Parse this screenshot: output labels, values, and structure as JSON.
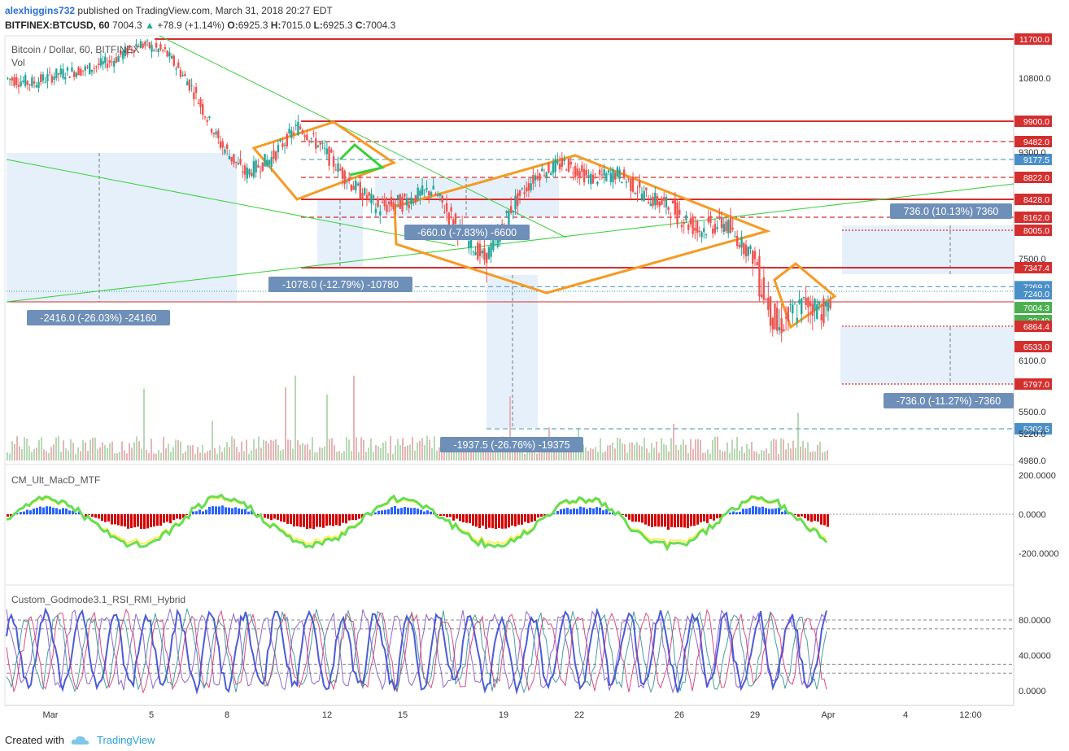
{
  "header": {
    "user": "alexhiggins732",
    "published": "published on TradingView.com, March 31, 2018 20:27 EDT",
    "symbol": "BITFINEX:BTCUSD, 60",
    "last": "7004.3",
    "change": "+78.9 (+1.14%)",
    "o_label": "O:",
    "o": "6925.3",
    "h_label": "H:",
    "h": "7015.0",
    "l_label": "L:",
    "l": "6925.3",
    "c_label": "C:",
    "c": "7004.3"
  },
  "main_pane": {
    "title": "Bitcoin / Dollar, 60, BITFINEX",
    "vol_label": "Vol"
  },
  "macd_pane": {
    "title": "CM_Ult_MacD_MTF"
  },
  "rsi_pane": {
    "title": "Custom_Godmode3.1_RSI_RMI_Hybrid"
  },
  "footer": {
    "created_with": "Created with",
    "brand": "TradingView"
  },
  "colors": {
    "bull": "#26a69a",
    "bear": "#ef5350",
    "orange": "#f59a23",
    "red_level": "#d32f2f",
    "blue_level": "#64a6c9",
    "green_line": "#39d039",
    "measure_bg": "#dcebfa",
    "measure_label": "#6e8fb8"
  },
  "chart_data": [
    {
      "type": "line",
      "title": "Bitcoin / Dollar, 60, BITFINEX",
      "x_ticks": [
        "Mar",
        "5",
        "8",
        "12",
        "15",
        "19",
        "22",
        "26",
        "29",
        "Apr",
        "4",
        "12:00"
      ],
      "y_ticks": [
        10800.0,
        9300.0,
        7500.0,
        6100.0,
        5500.0,
        5220.0,
        4980.0
      ],
      "series": [
        {
          "x": [
            0,
            1,
            2,
            3,
            4,
            5,
            6,
            7,
            8,
            9,
            10,
            11,
            12,
            13,
            14,
            15,
            16,
            17,
            18,
            19,
            20,
            21,
            22,
            23,
            24,
            25,
            26,
            27,
            28,
            29,
            30,
            31
          ],
          "values": [
            10800,
            10700,
            10900,
            11000,
            11200,
            11600,
            11400,
            10600,
            9500,
            8900,
            9200,
            9800,
            9300,
            8700,
            8300,
            8400,
            8600,
            8000,
            7500,
            8300,
            8900,
            9100,
            8800,
            8900,
            8500,
            8300,
            8000,
            8100,
            7600,
            6800,
            7100,
            7004
          ]
        }
      ],
      "price_levels": [
        {
          "label": "11700.0",
          "style": "red-solid"
        },
        {
          "label": "9900.0",
          "style": "red-solid"
        },
        {
          "label": "9482.0",
          "style": "red-dashed"
        },
        {
          "label": "9177.5",
          "style": "blue-dashed"
        },
        {
          "label": "8822.0",
          "style": "red-dashed"
        },
        {
          "label": "8428.0",
          "style": "red-solid"
        },
        {
          "label": "8162.0",
          "style": "red-dashed"
        },
        {
          "label": "8005.0",
          "style": "red-dotted"
        },
        {
          "label": "7347.4",
          "style": "red-solid"
        },
        {
          "label": "7269.0",
          "style": "blue-dashed"
        },
        {
          "label": "7240.0",
          "style": "blue-tag"
        },
        {
          "label": "7004.3",
          "style": "green-tag"
        },
        {
          "label": "32:49",
          "style": "green-tag"
        },
        {
          "label": "6864.4",
          "style": "red-dotted"
        },
        {
          "label": "6533.0",
          "style": "red-tag"
        },
        {
          "label": "5797.0",
          "style": "red-dotted"
        },
        {
          "label": "5302.5",
          "style": "blue-dashed"
        }
      ],
      "measurements": [
        "-2416.0 (-26.03%) -24160",
        "-1078.0 (-12.79%) -10780",
        "-660.0 (-7.83%) -6600",
        "-1937.5 (-26.76%) -19375",
        "736.0 (10.13%) 7360",
        "-736.0 (-11.27%) -7360"
      ]
    },
    {
      "type": "bar",
      "title": "CM_Ult_MacD_MTF",
      "y_ticks": [
        "200.0000",
        "0.0000",
        "-200.0000"
      ],
      "ylim": [
        -300,
        220
      ]
    },
    {
      "type": "line",
      "title": "Custom_Godmode3.1_RSI_RMI_Hybrid",
      "y_ticks": [
        "80.0000",
        "40.0000",
        "0.0000"
      ],
      "ylim": [
        -5,
        100
      ],
      "levels": [
        80,
        70,
        30,
        20
      ]
    }
  ]
}
